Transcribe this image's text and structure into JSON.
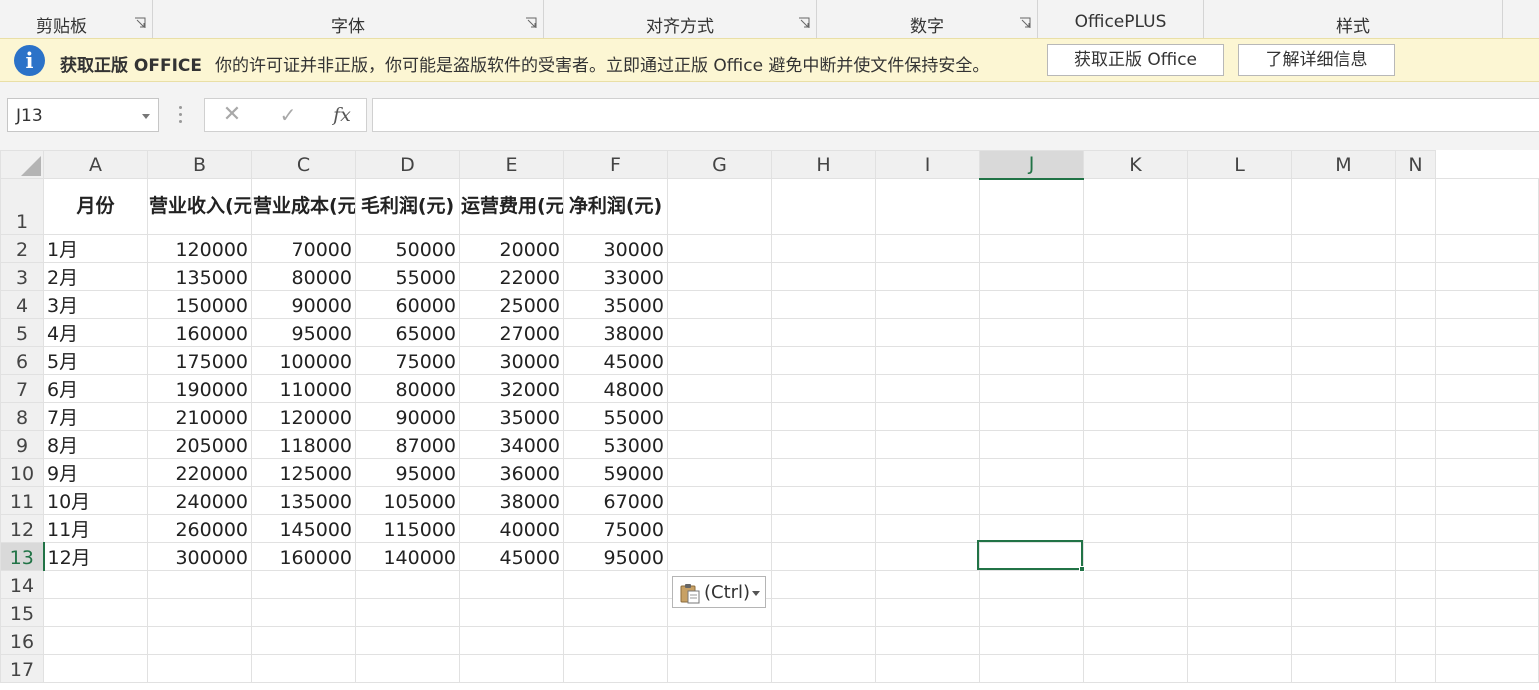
{
  "ribbon": {
    "groups": [
      "剪贴板",
      "字体",
      "对齐方式",
      "数字",
      "OfficePLUS",
      "样式"
    ]
  },
  "message_bar": {
    "title": "获取正版 OFFICE",
    "text": "你的许可证并非正版，你可能是盗版软件的受害者。立即通过正版 Office 避免中断并使文件保持安全。",
    "button_get": "获取正版 Office",
    "button_learn": "了解详细信息"
  },
  "formula_bar": {
    "name_box": "J13",
    "formula": "",
    "fx_label": "fx",
    "cancel_glyph": "✕",
    "enter_glyph": "✓"
  },
  "sheet": {
    "columns": [
      "A",
      "B",
      "C",
      "D",
      "E",
      "F",
      "G",
      "H",
      "I",
      "J",
      "K",
      "L",
      "M",
      "N"
    ],
    "selected_column": "J",
    "selected_row": "13",
    "headers": [
      "月份",
      "营业收入(元)",
      "营业成本(元)",
      "毛利润(元)",
      "运营费用(元)",
      "净利润(元)"
    ],
    "rows": [
      [
        "1月",
        "120000",
        "70000",
        "50000",
        "20000",
        "30000"
      ],
      [
        "2月",
        "135000",
        "80000",
        "55000",
        "22000",
        "33000"
      ],
      [
        "3月",
        "150000",
        "90000",
        "60000",
        "25000",
        "35000"
      ],
      [
        "4月",
        "160000",
        "95000",
        "65000",
        "27000",
        "38000"
      ],
      [
        "5月",
        "175000",
        "100000",
        "75000",
        "30000",
        "45000"
      ],
      [
        "6月",
        "190000",
        "110000",
        "80000",
        "32000",
        "48000"
      ],
      [
        "7月",
        "210000",
        "120000",
        "90000",
        "35000",
        "55000"
      ],
      [
        "8月",
        "205000",
        "118000",
        "87000",
        "34000",
        "53000"
      ],
      [
        "9月",
        "220000",
        "125000",
        "95000",
        "36000",
        "59000"
      ],
      [
        "10月",
        "240000",
        "135000",
        "105000",
        "38000",
        "67000"
      ],
      [
        "11月",
        "260000",
        "145000",
        "115000",
        "40000",
        "75000"
      ],
      [
        "12月",
        "300000",
        "160000",
        "140000",
        "45000",
        "95000"
      ]
    ],
    "row_numbers": [
      "1",
      "2",
      "3",
      "4",
      "5",
      "6",
      "7",
      "8",
      "9",
      "10",
      "11",
      "12",
      "13",
      "14",
      "15",
      "16",
      "17"
    ]
  },
  "paste_options": {
    "label": "(Ctrl)"
  },
  "colors": {
    "accent_green": "#217346",
    "info_blue": "#2b72c8",
    "message_bar_bg": "#fcf6d3"
  },
  "icons": [
    "dialog-launcher-icon",
    "info-icon",
    "cancel-icon",
    "enter-icon",
    "function-icon",
    "clipboard-icon",
    "dropdown-arrow-icon"
  ]
}
